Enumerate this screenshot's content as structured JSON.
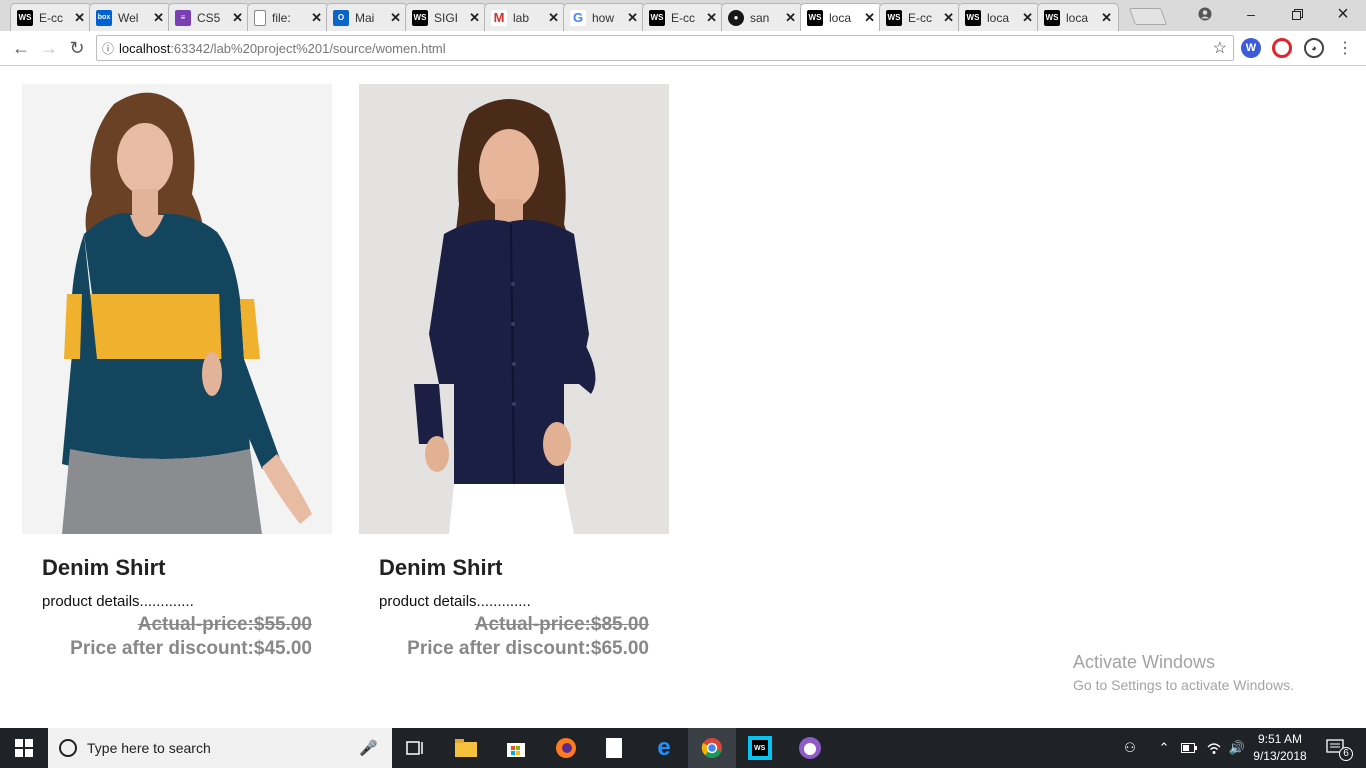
{
  "browser": {
    "tabs": [
      {
        "title": "E-cc",
        "favicon": "ws-icon",
        "color": "#000000",
        "glyph": "WS"
      },
      {
        "title": "Wel",
        "favicon": "box-icon",
        "color": "#0061d5",
        "glyph": "box"
      },
      {
        "title": "CS5",
        "favicon": "list-icon",
        "color": "#7b3fb5",
        "glyph": "≡"
      },
      {
        "title": "file:",
        "favicon": "file-icon",
        "color": "#ffffff",
        "glyph": ""
      },
      {
        "title": "Mai",
        "favicon": "outlook-icon",
        "color": "#0a64c9",
        "glyph": "O"
      },
      {
        "title": "SIGI",
        "favicon": "ws-icon",
        "color": "#000000",
        "glyph": "WS"
      },
      {
        "title": "lab",
        "favicon": "gmail-icon",
        "color": "#ffffff",
        "glyph": "M"
      },
      {
        "title": "how",
        "favicon": "google-icon",
        "color": "#ffffff",
        "glyph": "G"
      },
      {
        "title": "E-cc",
        "favicon": "ws-icon",
        "color": "#000000",
        "glyph": "WS"
      },
      {
        "title": "san",
        "favicon": "github-icon",
        "color": "#181717",
        "glyph": "●"
      },
      {
        "title": "loca",
        "favicon": "ws-icon",
        "color": "#000000",
        "glyph": "WS",
        "active": true
      },
      {
        "title": "E-cc",
        "favicon": "ws-icon",
        "color": "#000000",
        "glyph": "WS"
      },
      {
        "title": "loca",
        "favicon": "ws-icon",
        "color": "#000000",
        "glyph": "WS"
      },
      {
        "title": "loca",
        "favicon": "ws-icon",
        "color": "#000000",
        "glyph": "WS"
      }
    ],
    "url_host": "localhost",
    "url_rest": ":63342/lab%20project%201/source/women.html"
  },
  "products": [
    {
      "name": "Denim Shirt",
      "details": "product details.............",
      "actual_price": "Actual-price:$55.00",
      "discount_price": "Price after discount:$45.00",
      "image": "woman-in-teal-and-yellow-striped-top"
    },
    {
      "name": "Denim Shirt",
      "details": "product details.............",
      "actual_price": "Actual-price:$85.00",
      "discount_price": "Price after discount:$65.00",
      "image": "woman-in-navy-button-shirt"
    }
  ],
  "watermark": {
    "line1": "Activate Windows",
    "line2": "Go to Settings to activate Windows."
  },
  "taskbar": {
    "search_placeholder": "Type here to search",
    "time": "9:51 AM",
    "date": "9/13/2018",
    "notification_count": "6"
  }
}
